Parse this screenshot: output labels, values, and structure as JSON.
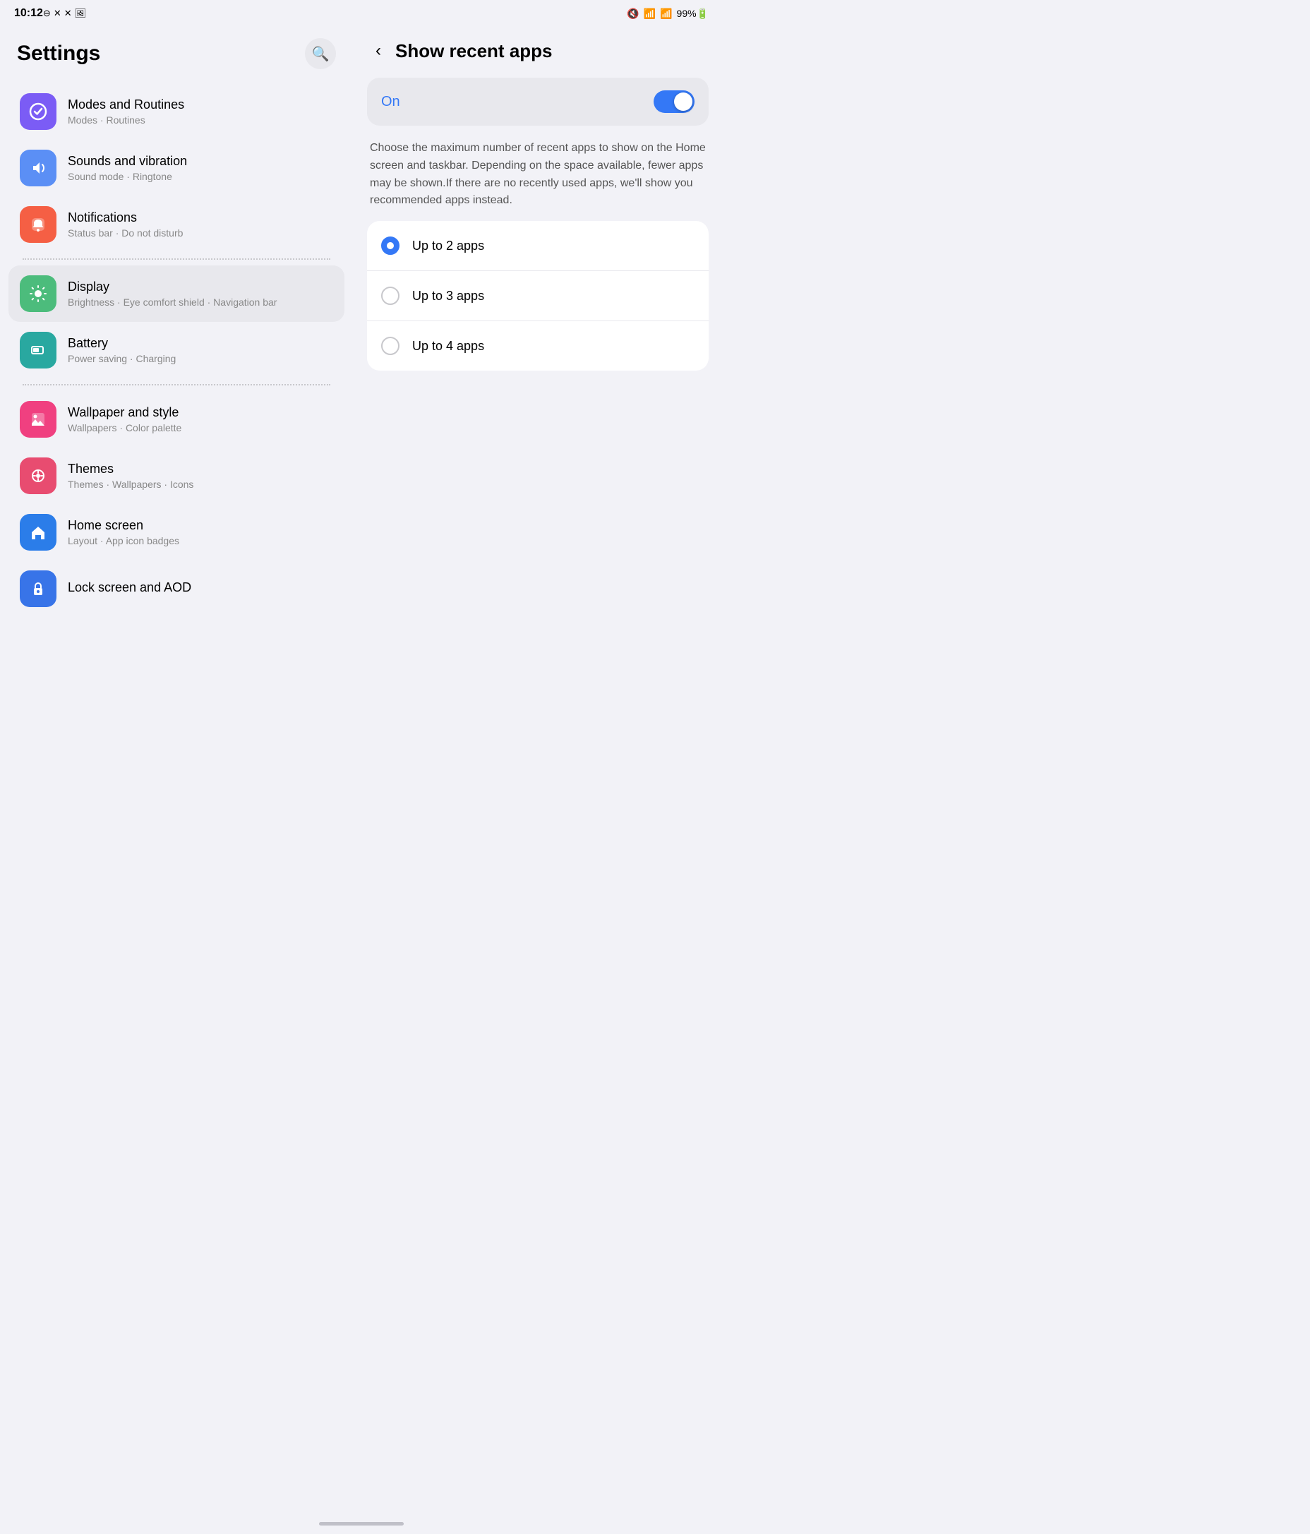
{
  "statusBar": {
    "time": "10:12",
    "notifIcons": [
      "⊖",
      "✕",
      "✕",
      "🖼"
    ],
    "rightIcons": {
      "mute": "🔇",
      "wifi": "WiFi",
      "signal": "Signal",
      "battery": "99%"
    }
  },
  "leftPanel": {
    "title": "Settings",
    "searchAriaLabel": "Search",
    "items": [
      {
        "id": "modes-routines",
        "name": "Modes and Routines",
        "sub": "Modes · Routines",
        "iconColor": "icon-purple",
        "iconSymbol": "✓"
      },
      {
        "id": "sounds-vibration",
        "name": "Sounds and vibration",
        "sub": "Sound mode · Ringtone",
        "iconColor": "icon-blue",
        "iconSymbol": "🔊"
      },
      {
        "id": "notifications",
        "name": "Notifications",
        "sub": "Status bar · Do not disturb",
        "iconColor": "icon-orange",
        "iconSymbol": "🔔"
      },
      "divider",
      {
        "id": "display",
        "name": "Display",
        "sub": "Brightness · Eye comfort shield · Navigation bar",
        "iconColor": "icon-green",
        "iconSymbol": "☀",
        "active": true
      },
      {
        "id": "battery",
        "name": "Battery",
        "sub": "Power saving · Charging",
        "iconColor": "icon-teal",
        "iconSymbol": "🔋"
      },
      "divider",
      {
        "id": "wallpaper",
        "name": "Wallpaper and style",
        "sub": "Wallpapers · Color palette",
        "iconColor": "icon-pink",
        "iconSymbol": "🖼"
      },
      {
        "id": "themes",
        "name": "Themes",
        "sub": "Themes · Wallpapers · Icons",
        "iconColor": "icon-red",
        "iconSymbol": "🎨"
      },
      {
        "id": "home-screen",
        "name": "Home screen",
        "sub": "Layout · App icon badges",
        "iconColor": "icon-homeblue",
        "iconSymbol": "🏠"
      },
      {
        "id": "lock-screen",
        "name": "Lock screen and AOD",
        "sub": "",
        "iconColor": "icon-lockblue",
        "iconSymbol": "🔒"
      }
    ]
  },
  "rightPanel": {
    "backLabel": "‹",
    "title": "Show recent apps",
    "toggleLabel": "On",
    "toggleOn": true,
    "description": "Choose the maximum number of recent apps to show on the Home screen and taskbar. Depending on the space available, fewer apps may be shown.If there are no recently used apps, we'll show you recommended apps instead.",
    "radioOptions": [
      {
        "id": "up-to-2",
        "label": "Up to 2 apps",
        "selected": true
      },
      {
        "id": "up-to-3",
        "label": "Up to 3 apps",
        "selected": false
      },
      {
        "id": "up-to-4",
        "label": "Up to 4 apps",
        "selected": false
      }
    ]
  }
}
